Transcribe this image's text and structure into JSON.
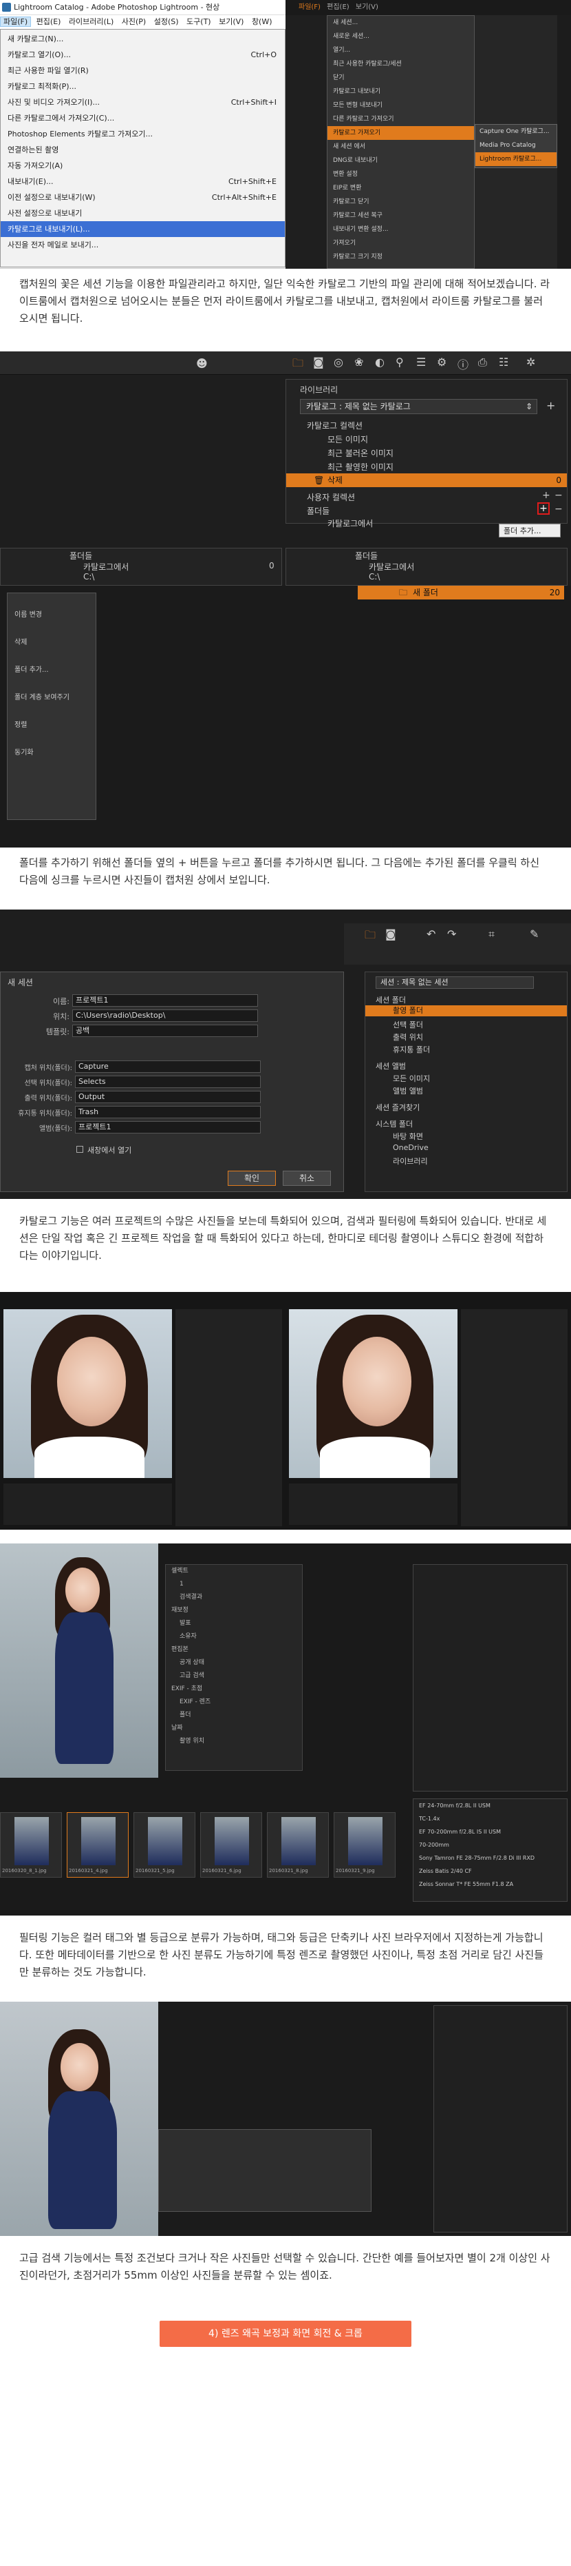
{
  "s1": {
    "title": "Lightroom Catalog - Adobe Photoshop Lightroom - 현상",
    "menubar": [
      "파일(F)",
      "편집(E)",
      "라이브러리(L)",
      "사진(P)",
      "설정(S)",
      "도구(T)",
      "보기(V)",
      "창(W)",
      "도움말(H)"
    ],
    "file_menu": [
      [
        "새 카탈로그(N)...",
        ""
      ],
      [
        "카탈로그 열기(O)...",
        "Ctrl+O"
      ],
      [
        "최근 사용한 파일 열기(R)",
        ""
      ],
      [
        "카탈로그 최적화(P)...",
        ""
      ],
      [
        "사진 및 비디오 가져오기(I)...",
        "Ctrl+Shift+I"
      ],
      [
        "다른 카탈로그에서 가져오기(C)...",
        ""
      ],
      [
        "Photoshop Elements 카탈로그 가져오기...",
        ""
      ],
      [
        "연결하는된 촬영",
        ""
      ],
      [
        "자동 가져오기(A)",
        ""
      ],
      [
        "내보내기(E)...",
        "Ctrl+Shift+E"
      ],
      [
        "이전 설정으로 내보내기(W)",
        "Ctrl+Alt+Shift+E"
      ],
      [
        "사전 설정으로 내보내기",
        ""
      ],
      [
        "카탈로그로 내보내기(L)...",
        ""
      ],
      [
        "사진을 전자 메일로 보내기...",
        ""
      ]
    ],
    "right_menu": [
      "새 세션...",
      "새로운 세션...",
      "열기...",
      "최근 사용한 카탈로그/세션",
      "닫기",
      "카탈로그 내보내기",
      "모든 변형 내보내기",
      "다른 카탈로그 가져오기",
      "카탈로그 가져오기",
      "새 세션 에서",
      "DNG로 내보내기",
      "변환 설정",
      "EIP로 변환",
      "카탈로그 닫기",
      "카탈로그 세션 복구",
      "내보내기 변환 설정...",
      "가져오기",
      "카탈로그 크기 지정"
    ],
    "submenu": [
      "Capture One 카탈로그...",
      "Media Pro Catalog",
      "Lightroom 카탈로그..."
    ]
  },
  "p1": "캡처원의 꽃은 세션 기능을 이용한 파일관리라고 하지만, 일단 익숙한 카탈로그 기반의 파일 관리에 대해 적어보겠습니다. 라이트룸에서 캡처원으로 넘어오시는 분들은 먼저 라이트룸에서 카탈로그를 내보내고, 캡처원에서 라이트룸 카탈로그를 불러오시면 됩니다.",
  "s2": {
    "header": "라이브러리",
    "catalog_select": "카탈로그 : 제목 없는 카탈로그",
    "collections_label": "카탈로그 컬렉션",
    "collections": [
      "모든 이미지",
      "최근 불러온 이미지",
      "최근 촬영한 이미지",
      "삭제"
    ],
    "trash_count": "0",
    "user_collections": "사용자 컬렉션",
    "folders_label": "폴더들",
    "folder_item": "카탈로그에서",
    "tooltip": "폴더 추가...",
    "left_folders": "폴더들",
    "left_folder_item": "카탈로그에서",
    "left_drive": "C:\\",
    "left_count": "0",
    "right_folders": "폴더들",
    "right_folder_item": "카탈로그에서",
    "right_drive": "C:\\",
    "new_folder": "새 폴더",
    "new_folder_count": "20",
    "context_menu": [
      "이름 변경",
      "삭제",
      "폴더 추가...",
      "폴더 계층 보여주기",
      "정렬",
      "동기화"
    ]
  },
  "p2": "폴더를 추가하기 위해선 폴더들 옆의 + 버튼을 누르고 폴더를 추가하시면 됩니다. 그 다음에는 추가된 폴더를 우클릭 하신 다음에 싱크를 누르시면 사진들이 캡처원 상에서 보입니다.",
  "s3": {
    "dialog_title": "새 세션",
    "fields": [
      [
        "이름:",
        "프로젝트1"
      ],
      [
        "위치:",
        "C:\\Users\\radio\\Desktop\\"
      ],
      [
        "템플릿:",
        "공백"
      ]
    ],
    "folders": [
      [
        "캡처 위치(폴더):",
        "Capture"
      ],
      [
        "선택 위치(폴더):",
        "Selects"
      ],
      [
        "출력 위치(폴더):",
        "Output"
      ],
      [
        "휴지통 위치(폴더):",
        "Trash"
      ],
      [
        "앨범(폴더):",
        "프로젝트1"
      ]
    ],
    "open_checkbox": "새창에서 열기",
    "ok": "확인",
    "cancel": "취소",
    "session_select": "세션 : 제목 없는 세션",
    "session_folders_label": "세션 폴더",
    "session_folders": [
      "촬영 폴더",
      "선택 폴더",
      "출력 위치",
      "휴지통 폴더"
    ],
    "session_collections_label": "세션 앨범",
    "session_collections": [
      "모든 이미지",
      "앨범 앨범"
    ],
    "session_favorites": "세션 즐겨찾기",
    "system_folders": "시스템 폴더",
    "system_items": [
      "바탕 화면",
      "OneDrive",
      "라이브러리"
    ]
  },
  "p3": "카탈로그 기능은 여러 프로젝트의 수많은 사진들을 보는데 특화되어 있으며, 검색과 필터링에 특화되어 있습니다. 반대로 세션은 단일 작업 혹은 긴 프로젝트 작업을 할 때 특화되어 있다고 하는데, 한마디로 테더링 촬영이나 스튜디오 환경에 적합하다는 이야기입니다.",
  "p4": "필터링 기능은 컬러 태그와 별 등급으로 분류가 가능하며, 태그와 등급은 단축키나 사진 브라우저에서 지정하는게 가능합니다. 또한 메타데이터를 기반으로 한 사진 분류도 가능하기에 특정 렌즈로 촬영했던 사진이나, 특정 초점 거리로 담긴 사진들만 분류하는 것도 가능합니다.",
  "s5": {
    "filter_items": [
      "셀렉트",
      "1",
      "검색결과",
      "재보정",
      "발표",
      "소유자",
      "편집본",
      "공개 상태",
      "고급 검색",
      "EXIF - 초점",
      "EXIF - 렌즈",
      "폴더",
      "날짜",
      "촬영 위치"
    ],
    "lens_list": [
      "EF 24-70mm f/2.8L II USM",
      "TC-1.4x",
      "EF 70-200mm f/2.8L IS II USM",
      "70-200mm",
      "Sony Tamron FE 28-75mm F/2.8 Di III RXD",
      "Zeiss Batis 2/40 CF",
      "Zeiss Sonnar T* FE 55mm F1.8 ZA"
    ],
    "thumb_captions": [
      "20160320_8_1.jpg",
      "20160321_4.jpg",
      "20160321_5.jpg",
      "20160321_6.jpg",
      "20160321_8.jpg",
      "20160321_9.jpg"
    ]
  },
  "p5": "고급 검색 기능에서는 특정 조건보다 크거나 작은 사진들만 선택할 수 있습니다. 간단한 예를 들어보자면 별이 2개 이상인 사진이라던가, 초점거리가 55mm 이상인 사진들을 분류할 수 있는 셈이죠.",
  "section_button": "4) 렌즈 왜곡 보정과 화면 회전 & 크롭",
  "colors": {
    "accent": "#e07b1d",
    "panel": "#2b2b2b",
    "menu_highlight": "#3b6fd4",
    "section_button": "#f46c47"
  }
}
